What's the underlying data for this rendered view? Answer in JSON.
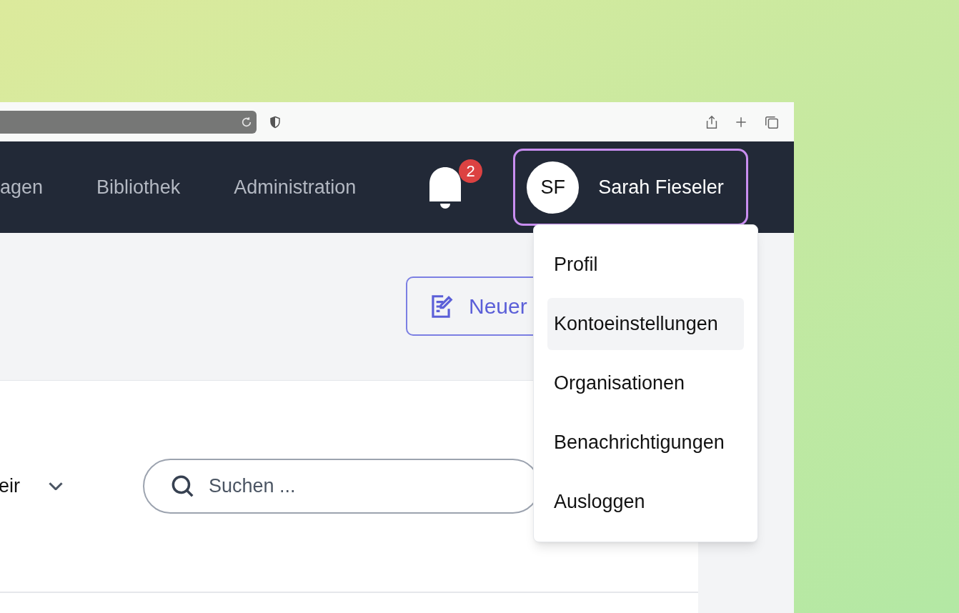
{
  "nav": {
    "items": [
      {
        "label": "agen"
      },
      {
        "label": "Bibliothek"
      },
      {
        "label": "Administration"
      }
    ],
    "notifications": {
      "count": "2"
    },
    "user": {
      "initials": "SF",
      "name": "Sarah Fieseler",
      "menu_open": true
    }
  },
  "toolbar": {
    "new_button": "Neuer"
  },
  "filter": {
    "value": "eir",
    "search_placeholder": "Suchen ..."
  },
  "user_menu": [
    {
      "label": "Profil",
      "selected": false
    },
    {
      "label": "Kontoeinstellungen",
      "selected": true
    },
    {
      "label": "Organisationen",
      "selected": false
    },
    {
      "label": "Benachrichtigungen",
      "selected": false
    },
    {
      "label": "Ausloggen",
      "selected": false
    }
  ]
}
